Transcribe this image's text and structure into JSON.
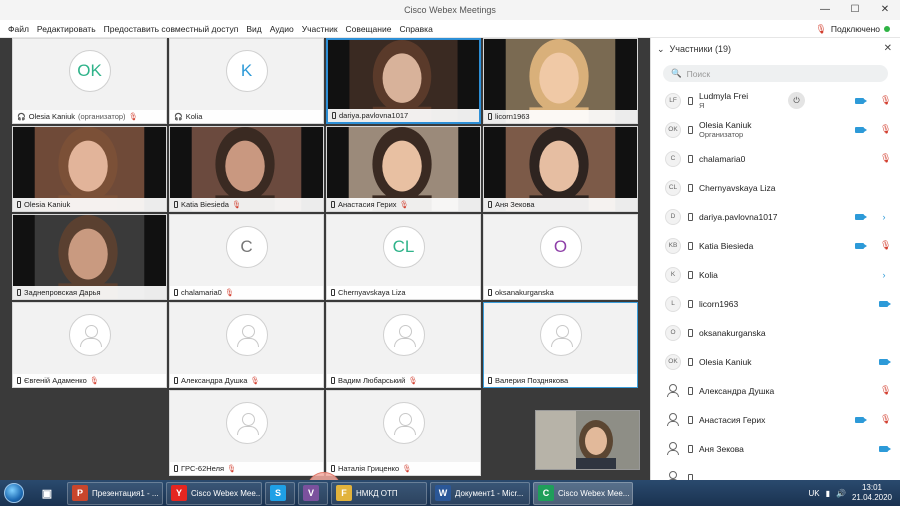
{
  "window": {
    "title": "Cisco Webex Meetings",
    "minimize": "—",
    "maximize": "☐",
    "close": "✕"
  },
  "menu": {
    "items": [
      "Файл",
      "Редактировать",
      "Предоставить совместный доступ",
      "Вид",
      "Аудио",
      "Участник",
      "Совещание",
      "Справка"
    ],
    "status": "Подключено"
  },
  "tiles": [
    {
      "name": "Olesia Kaniuk",
      "suffix": "(организатор)",
      "initials": "OK",
      "initials_color": "#2fb38a",
      "muted": true,
      "icon": "headset"
    },
    {
      "name": "Kolia",
      "initials": "K",
      "initials_color": "#2d9ad8",
      "muted": false,
      "icon": "headset"
    },
    {
      "name": "dariya.pavlovna1017",
      "video": true,
      "muted": false,
      "icon": "phone"
    },
    {
      "name": "licorn1963",
      "video": true,
      "muted": false,
      "icon": "phone"
    },
    {
      "name": "Olesia Kaniuk",
      "video": true,
      "muted": false,
      "icon": "phone"
    },
    {
      "name": "Katia Biesieda",
      "video": true,
      "muted": true,
      "icon": "phone"
    },
    {
      "name": "Анастасия Герих",
      "video": true,
      "muted": true,
      "icon": "phone"
    },
    {
      "name": "Аня Зекова",
      "video": true,
      "muted": false,
      "icon": "phone"
    },
    {
      "name": "Заднепровская Дарья",
      "video": true,
      "muted": false,
      "icon": "phone"
    },
    {
      "name": "chalamaria0",
      "initials": "C",
      "initials_color": "#777777",
      "muted": true,
      "icon": "phone"
    },
    {
      "name": "Chernyavskaya Liza",
      "initials": "CL",
      "initials_color": "#2fb38a",
      "muted": false,
      "icon": "phone"
    },
    {
      "name": "oksanakurganska",
      "initials": "O",
      "initials_color": "#8e3fa8",
      "muted": false,
      "icon": "phone"
    },
    {
      "name": "Євгеній Адаменко",
      "muted": true,
      "icon": "phone"
    },
    {
      "name": "Александра Душка",
      "muted": true,
      "icon": "phone"
    },
    {
      "name": "Вадим Любарський",
      "muted": true,
      "icon": "phone"
    },
    {
      "name": "Валерия Позднякова",
      "muted": false,
      "icon": "phone"
    },
    {
      "name": "ГРС-62Неля",
      "muted": true,
      "icon": "phone"
    },
    {
      "name": "Наталія Гриценко",
      "muted": true,
      "icon": "phone"
    }
  ],
  "participants": {
    "header": "Участники (19)",
    "search_placeholder": "Поиск",
    "list": [
      {
        "initials": "LF",
        "name": "Ludmyla Frei",
        "sub": "Я",
        "icons": [
          "camera",
          "mic-muted"
        ]
      },
      {
        "initials": "OK",
        "name": "Olesia Kaniuk",
        "sub": "Организатор",
        "icons": [
          "camera",
          "mic-muted"
        ]
      },
      {
        "initials": "C",
        "name": "chalamaria0",
        "icons": [
          "mic-muted"
        ]
      },
      {
        "initials": "CL",
        "name": "Chernyavskaya Liza",
        "icons": []
      },
      {
        "initials": "D",
        "name": "dariya.pavlovna1017",
        "icons": [
          "camera",
          "chevron"
        ]
      },
      {
        "initials": "KB",
        "name": "Katia Biesieda",
        "icons": [
          "camera",
          "mic-muted"
        ]
      },
      {
        "initials": "K",
        "name": "Kolia",
        "icons": [
          "chevron"
        ]
      },
      {
        "initials": "L",
        "name": "licorn1963",
        "icons": [
          "camera"
        ]
      },
      {
        "initials": "O",
        "name": "oksanakurganska",
        "icons": []
      },
      {
        "initials": "OK",
        "name": "Olesia Kaniuk",
        "icons": [
          "camera"
        ]
      },
      {
        "initials": "",
        "name": "Александра Душка",
        "icons": [
          "mic-muted"
        ]
      },
      {
        "initials": "",
        "name": "Анастасия Герих",
        "icons": [
          "camera",
          "mic-muted"
        ]
      },
      {
        "initials": "",
        "name": "Аня Зекова",
        "icons": [
          "camera"
        ]
      },
      {
        "initials": "",
        "name": "",
        "icons": []
      }
    ]
  },
  "taskbar": {
    "buttons": [
      {
        "label": "Презентация1 - ...",
        "icon": "P",
        "color": "#c8462c"
      },
      {
        "label": "Cisco Webex Mee...",
        "icon": "Y",
        "color": "#e52620"
      },
      {
        "label": "",
        "icon": "S",
        "color": "#1fa0e6"
      },
      {
        "label": "",
        "icon": "V",
        "color": "#7b519d"
      },
      {
        "label": "НМКД ОТП",
        "icon": "F",
        "color": "#e2b33c"
      },
      {
        "label": "Документ1 - Micr...",
        "icon": "W",
        "color": "#2b5797"
      },
      {
        "label": "Cisco Webex Mee...",
        "icon": "C",
        "color": "#1f9e5a"
      }
    ],
    "lang": "UK",
    "time": "13:01",
    "date": "21.04.2020"
  }
}
